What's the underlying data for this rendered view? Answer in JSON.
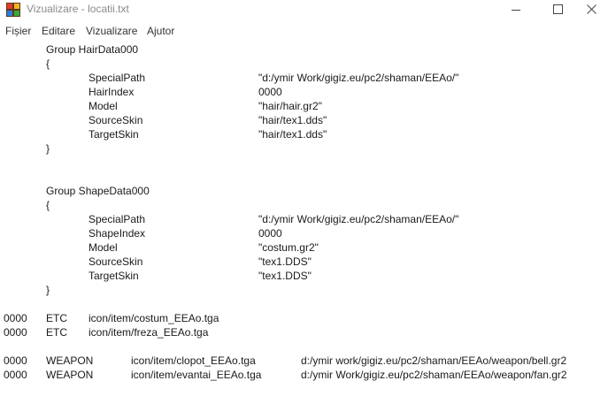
{
  "window": {
    "title": "Vizualizare - locatii.txt"
  },
  "menu": [
    "Fișier",
    "Editare",
    "Vizualizare",
    "Ajutor"
  ],
  "document": {
    "hair_group": {
      "header": "Group HairData000",
      "open": "{",
      "close": "}",
      "rows": [
        [
          "SpecialPath",
          "\"d:/ymir Work/gigiz.eu/pc2/shaman/EEAo/\""
        ],
        [
          "HairIndex",
          "0000"
        ],
        [
          "Model",
          "\"hair/hair.gr2\""
        ],
        [
          "SourceSkin",
          "\"hair/tex1.dds\""
        ],
        [
          "TargetSkin",
          "\"hair/tex1.dds\""
        ]
      ]
    },
    "shape_group": {
      "header": "Group ShapeData000",
      "open": "{",
      "close": "}",
      "rows": [
        [
          "SpecialPath",
          "\"d:/ymir Work/gigiz.eu/pc2/shaman/EEAo/\""
        ],
        [
          "ShapeIndex",
          "0000"
        ],
        [
          "Model",
          "\"costum.gr2\""
        ],
        [
          "SourceSkin",
          "\"tex1.DDS\""
        ],
        [
          "TargetSkin",
          "\"tex1.DDS\""
        ]
      ]
    },
    "etc_lines": [
      [
        "0000",
        "ETC",
        "icon/item/costum_EEAo.tga"
      ],
      [
        "0000",
        "ETC",
        "icon/item/freza_EEAo.tga"
      ]
    ],
    "weapon_lines": [
      [
        "0000",
        "WEAPON",
        "icon/item/clopot_EEAo.tga",
        "d:/ymir work/gigiz.eu/pc2/shaman/EEAo/weapon/bell.gr2"
      ],
      [
        "0000",
        "WEAPON",
        "icon/item/evantai_EEAo.tga",
        "d:/ymir Work/gigiz.eu/pc2/shaman/EEAo/weapon/fan.gr2"
      ]
    ]
  }
}
